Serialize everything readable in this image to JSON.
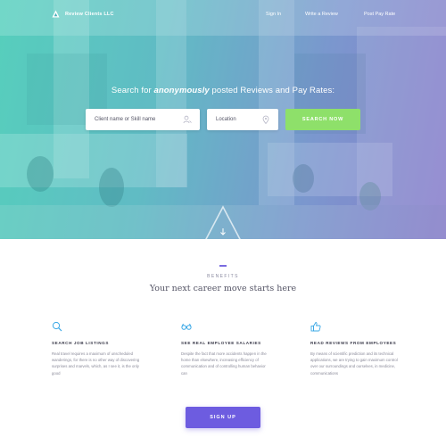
{
  "nav": {
    "brand": "Review Clients LLC",
    "links": [
      "Sign In",
      "Write a Review",
      "Post Pay Rate"
    ]
  },
  "hero": {
    "tagline_before": "Search for ",
    "tagline_emphasis": "anonymously",
    "tagline_after": " posted Reviews and Pay Rates:",
    "search": {
      "keyword_placeholder": "Client name or Skill name",
      "location_placeholder": "Location",
      "button_label": "SEARCH NOW"
    }
  },
  "benefits": {
    "eyebrow": "BENEFITS",
    "headline": "Your next career move starts here",
    "features": [
      {
        "icon": "magnifier-icon",
        "title": "SEARCH JOB LISTINGS",
        "body": "Real travel requires a maximum of unscheduled wanderings, for there is no other way of discovering surprises and marvels, which, as I see it, is the only good"
      },
      {
        "icon": "glasses-icon",
        "title": "SEE REAL EMPLOYEE SALARIES",
        "body": "Despite the fact that more accidents happen in the home than elsewhere, increasing efficiency of communication and of controlling human behavior can"
      },
      {
        "icon": "thumbs-up-icon",
        "title": "READ REVIEWS FROM EMPLOYEES",
        "body": "By means of scientific prediction and its technical applications, we are trying to gain maximum control over our surroundings and ourselves, in medicine, communications"
      }
    ],
    "cta_label": "SIGN UP"
  },
  "colors": {
    "accent_purple": "#6d5ce0",
    "accent_green": "#8ee06a",
    "hero_teal": "#3fc9b4",
    "hero_violet": "#7a6bc4",
    "feature_icon_blue": "#3aa8e6"
  }
}
